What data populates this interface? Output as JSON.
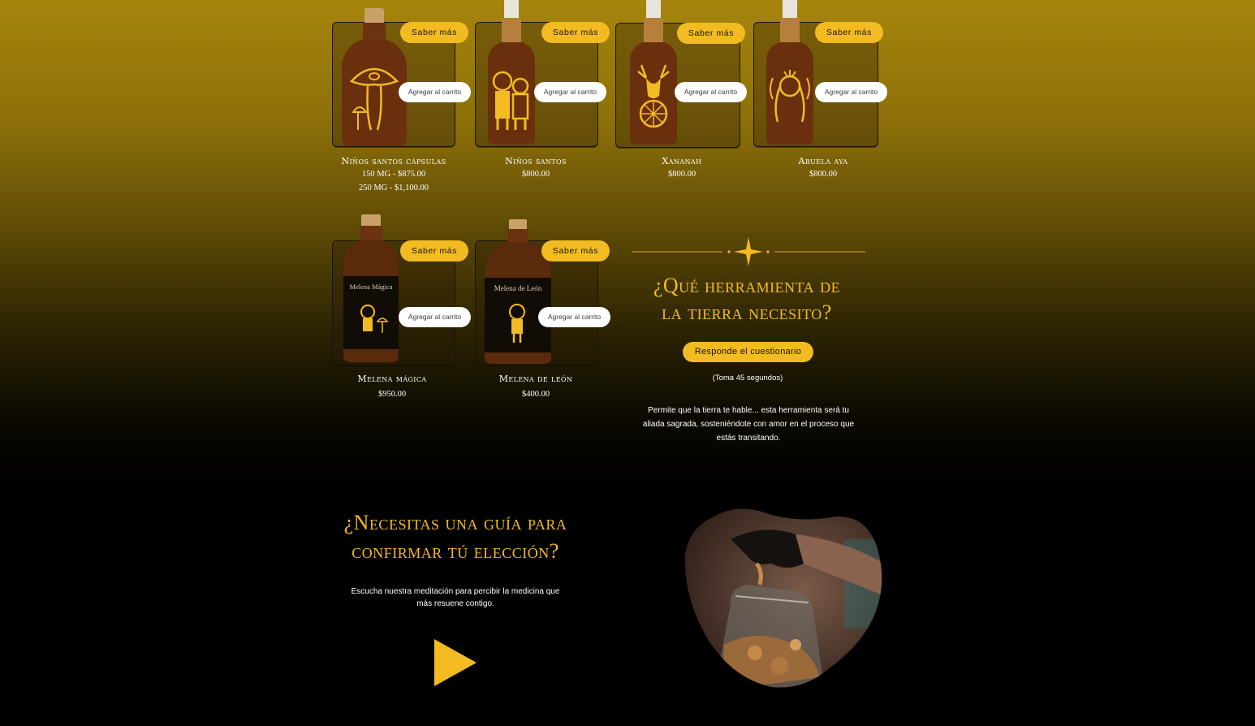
{
  "products": [
    {
      "name": "Niños santos cápsulas",
      "prices": [
        "150 MG - $875.00",
        "250 MG - $1,100.00"
      ],
      "saber": "Saber más",
      "cart": "Agregar al carrito"
    },
    {
      "name": "Niños santos",
      "prices": [
        "$800.00"
      ],
      "saber": "Saber más",
      "cart": "Agregar al carrito"
    },
    {
      "name": "Xananah",
      "prices": [
        "$800.00"
      ],
      "saber": "Saber más",
      "cart": "Agregar al carrito"
    },
    {
      "name": "Abuela aya",
      "prices": [
        "$800.00"
      ],
      "saber": "Saber más",
      "cart": "Agregar al carrito"
    },
    {
      "name": "Melena mágica",
      "prices": [
        "$950.00"
      ],
      "saber": "Saber más",
      "cart": "Agregar al carrito",
      "bottle_label": "Melena Mágica"
    },
    {
      "name": "Melena de león",
      "prices": [
        "$400.00"
      ],
      "saber": "Saber más",
      "cart": "Agregar al carrito",
      "bottle_label": "Melena de León"
    }
  ],
  "quiz": {
    "title_line1": "¿Qué herramienta de",
    "title_line2": "la tierra necesito?",
    "button": "Responde el cuestionario",
    "duration": "(Toma 45 segundos)",
    "description": "Permite que la tierra te hable... esta herramienta será tu aliada sagrada, sosteniéndote con amor en el proceso que estás transitando."
  },
  "guide": {
    "title_line1": "¿Necesitas una guía para",
    "title_line2": "confirmar tú elección?",
    "text": "Escucha nuestra meditación para percibir la medicina que más resuene contigo.",
    "play_icon": "play-icon"
  },
  "colors": {
    "accent": "#f2bb22",
    "amber": "#5a2a0c",
    "background_top": "#a6850c",
    "background_bottom": "#000000"
  }
}
